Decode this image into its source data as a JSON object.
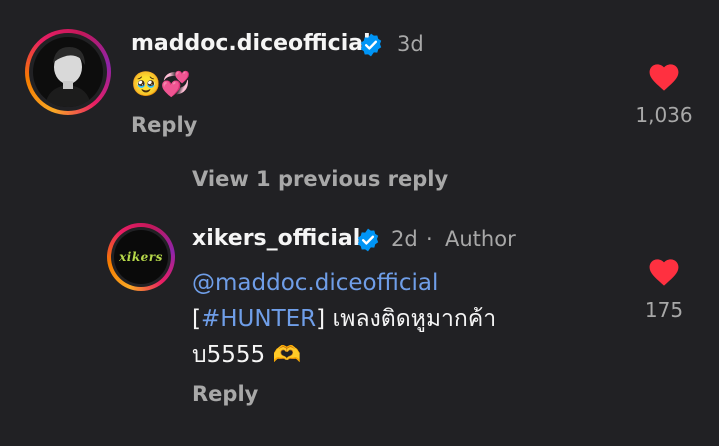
{
  "comments": [
    {
      "username": "maddoc.diceofficial",
      "time": "3d",
      "body_emoji": "🥹💞",
      "reply_label": "Reply",
      "like_count": "1,036"
    }
  ],
  "thread": {
    "view_previous": "View 1 previous reply"
  },
  "reply": {
    "username": "xikers_official",
    "time": "2d",
    "separator": "·",
    "author_label": "Author",
    "mention": "@maddoc.diceofficial",
    "line2_open": "[",
    "hashtag": "#HUNTER",
    "line2_rest": "] เพลงติดหูมากค้า",
    "line3": "บ5555 🫶",
    "reply_label": "Reply",
    "like_count": "175",
    "avatar_logo_text": "xikers"
  },
  "colors": {
    "background": "#212124",
    "like": "#ff3040",
    "verified": "#0095f6",
    "link": "#6f9ee8",
    "muted": "#a8a8a8"
  }
}
